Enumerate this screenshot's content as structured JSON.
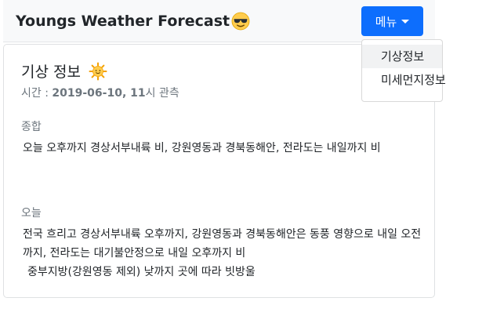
{
  "navbar": {
    "brand": "Youngs Weather Forecast",
    "brand_icon": "sunglasses-face-icon",
    "menu_button": "메뉴"
  },
  "dropdown": {
    "items": [
      {
        "label": "기상정보"
      },
      {
        "label": "미세먼지정보"
      }
    ]
  },
  "card": {
    "title": "기상 정보",
    "title_icon": "sun-icon",
    "time_prefix": "시간 : ",
    "time_value": "2019-06-10, 11",
    "time_suffix": "시 관측",
    "summary_label": "종합",
    "summary_text": "오늘 오후까지 경상서부내륙 비, 강원영동과 경북동해안, 전라도는 내일까지 비",
    "today_label": "오늘",
    "today_line1": "전국 흐리고 경상서부내륙 오후까지, 강원영동과 경북동해안은 동풍 영향으로 내일 오전까지, 전라도는 대기불안정으로 내일 오후까지 비",
    "today_line2": "중부지방(강원영동 제외) 낮까지 곳에 따라 빗방울"
  },
  "colors": {
    "primary": "#0d6efd",
    "navbar_bg": "#f8f9fa",
    "muted": "#6c757d"
  }
}
